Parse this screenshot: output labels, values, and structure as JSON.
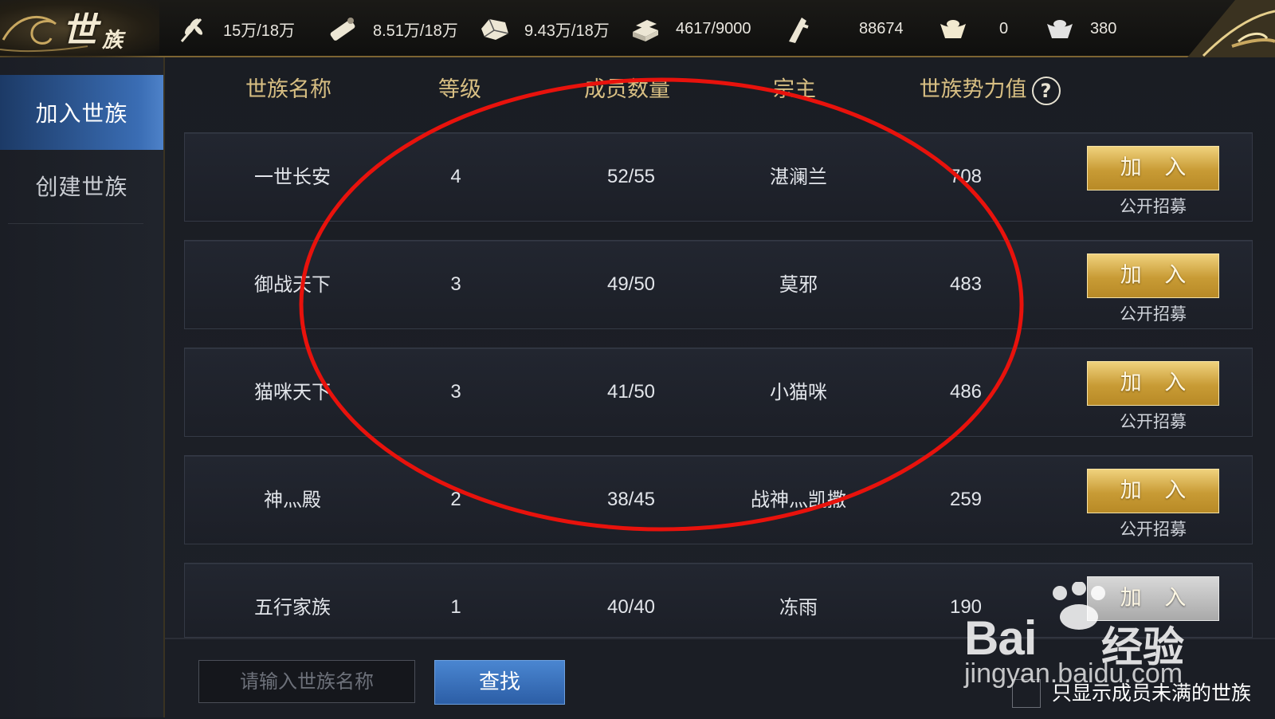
{
  "header": {
    "title_main": "世",
    "title_sub": "族",
    "resources": [
      {
        "icon": "grain-icon",
        "value": "15万/18万"
      },
      {
        "icon": "wood-icon",
        "value": "8.51万/18万"
      },
      {
        "icon": "stone-icon",
        "value": "9.43万/18万"
      },
      {
        "icon": "iron-icon",
        "value": "4617/9000"
      },
      {
        "icon": "order-token-icon",
        "value": "88674"
      },
      {
        "icon": "gold-ingot-icon",
        "value": "0"
      },
      {
        "icon": "silver-ingot-icon",
        "value": "380"
      }
    ]
  },
  "sidebar": {
    "items": [
      {
        "label": "加入世族",
        "active": true
      },
      {
        "label": "创建世族",
        "active": false
      }
    ]
  },
  "table": {
    "headers": {
      "name": "世族名称",
      "level": "等级",
      "members": "成员数量",
      "leader": "宗主",
      "power": "世族势力值"
    },
    "join_label": "加 入",
    "recruit_label": "公开招募",
    "rows": [
      {
        "name": "一世长安",
        "level": "4",
        "members": "52/55",
        "leader": "湛澜兰",
        "power": "708",
        "join_enabled": true
      },
      {
        "name": "御战天下",
        "level": "3",
        "members": "49/50",
        "leader": "莫邪",
        "power": "483",
        "join_enabled": true
      },
      {
        "name": "猫咪天下",
        "level": "3",
        "members": "41/50",
        "leader": "小猫咪",
        "power": "486",
        "join_enabled": true
      },
      {
        "name": "神灬殿",
        "level": "2",
        "members": "38/45",
        "leader": "战神灬凯撒",
        "power": "259",
        "join_enabled": true
      },
      {
        "name": "五行家族",
        "level": "1",
        "members": "40/40",
        "leader": "冻雨",
        "power": "190",
        "join_enabled": false
      }
    ]
  },
  "footer": {
    "search_placeholder": "请输入世族名称",
    "search_value": "",
    "search_button": "查找",
    "filter_label": "只显示成员未满的世族",
    "filter_checked": false
  },
  "watermark": {
    "brand": "Bai",
    "brand_cn": "经验",
    "url": "jingyan.baidu.com"
  },
  "colors": {
    "header_text": "#d8bf83",
    "active_tab": "#3a6db4",
    "join_button": "#c89b35",
    "search_button": "#2c5ea6",
    "annotation": "#e8120c"
  }
}
